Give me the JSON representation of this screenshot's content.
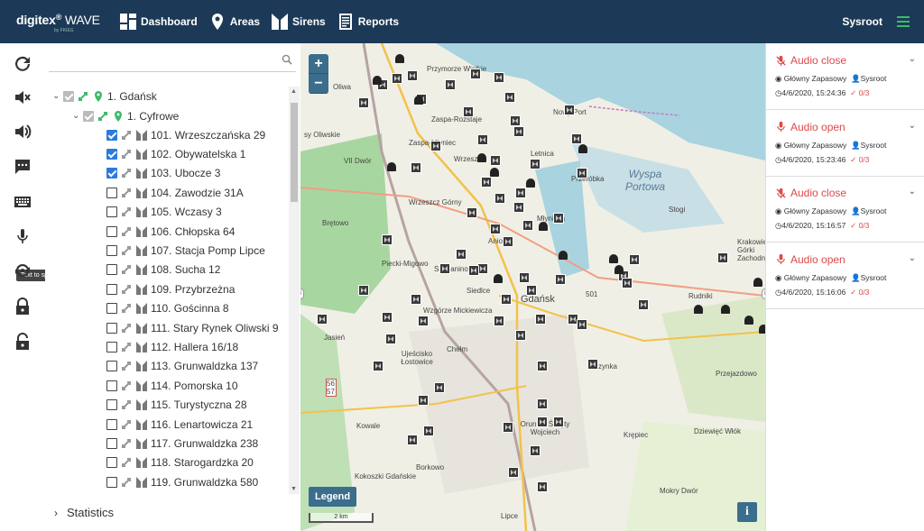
{
  "brand": {
    "name": "digitex",
    "product": "WAVE",
    "sub": "by FKIEG"
  },
  "nav": [
    {
      "label": "Dashboard",
      "icon": "dashboard-icon"
    },
    {
      "label": "Areas",
      "icon": "map-pin-icon"
    },
    {
      "label": "Sirens",
      "icon": "siren-icon"
    },
    {
      "label": "Reports",
      "icon": "report-icon"
    }
  ],
  "user": {
    "name": "Sysroot"
  },
  "toolbar": {
    "tooltip": "Text to speech"
  },
  "tree": {
    "root": "1. Gdańsk",
    "group": "1. Cyfrowe",
    "items": [
      {
        "label": "101. Wrzeszczańska 29",
        "checked": true
      },
      {
        "label": "102. Obywatelska 1",
        "checked": true
      },
      {
        "label": "103. Ubocze 3",
        "checked": true
      },
      {
        "label": "104. Zawodzie 31A",
        "checked": false
      },
      {
        "label": "105. Wczasy 3",
        "checked": false
      },
      {
        "label": "106. Chłopska 64",
        "checked": false
      },
      {
        "label": "107. Stacja Pomp Lipce",
        "checked": false
      },
      {
        "label": "108. Sucha 12",
        "checked": false
      },
      {
        "label": "109. Przybrzeżna",
        "checked": false
      },
      {
        "label": "110. Gościnna 8",
        "checked": false
      },
      {
        "label": "111. Stary Rynek Oliwski 9",
        "checked": false
      },
      {
        "label": "112. Hallera 16/18",
        "checked": false
      },
      {
        "label": "113. Grunwaldzka  137",
        "checked": false
      },
      {
        "label": "114. Pomorska 10",
        "checked": false
      },
      {
        "label": "115. Turystyczna 28",
        "checked": false
      },
      {
        "label": "116. Lenartowicza 21",
        "checked": false
      },
      {
        "label": "117. Grunwaldzka 238",
        "checked": false
      },
      {
        "label": "118. Starogardzka 20",
        "checked": false
      },
      {
        "label": "119. Grunwaldzka 580",
        "checked": false
      }
    ]
  },
  "stats": {
    "label": "Statistics"
  },
  "map": {
    "zoom_in": "+",
    "zoom_out": "−",
    "legend": "Legend",
    "scale": "2 km",
    "info": "i",
    "labels": [
      {
        "text": "Przymorze Wielkie",
        "cls": ""
      },
      {
        "text": "Zaspa-Rozstaje",
        "cls": ""
      },
      {
        "text": "Nowy Port",
        "cls": ""
      },
      {
        "text": "sy Oliwskie",
        "cls": ""
      },
      {
        "text": "VII Dwór",
        "cls": ""
      },
      {
        "text": "Zaspa-Młyniec",
        "cls": ""
      },
      {
        "text": "Wrzeszcz",
        "cls": ""
      },
      {
        "text": "Letnica",
        "cls": ""
      },
      {
        "text": "Przeróbka",
        "cls": ""
      },
      {
        "text": "Wyspa Portowa",
        "cls": "big"
      },
      {
        "text": "Wrzeszcz Górny",
        "cls": ""
      },
      {
        "text": "Stogi",
        "cls": ""
      },
      {
        "text": "Brętowo",
        "cls": ""
      },
      {
        "text": "Młyniska",
        "cls": ""
      },
      {
        "text": "Aniołki",
        "cls": ""
      },
      {
        "text": "Piecki-Migowo",
        "cls": ""
      },
      {
        "text": "Suchanino",
        "cls": ""
      },
      {
        "text": "Siedlce",
        "cls": ""
      },
      {
        "text": "Gdańsk",
        "cls": ""
      },
      {
        "text": "Wzgórze Mickiewicza",
        "cls": ""
      },
      {
        "text": "Jasień",
        "cls": ""
      },
      {
        "text": "Chełm",
        "cls": ""
      },
      {
        "text": "Ujeścisko Łostowice",
        "cls": ""
      },
      {
        "text": "Olszynka",
        "cls": ""
      },
      {
        "text": "Rudniki",
        "cls": ""
      },
      {
        "text": "Przejazdowo",
        "cls": ""
      },
      {
        "text": "Orunia - Święty Wojciech",
        "cls": ""
      },
      {
        "text": "Kowale",
        "cls": ""
      },
      {
        "text": "Krępiec",
        "cls": ""
      },
      {
        "text": "Dziewięć Włók",
        "cls": ""
      },
      {
        "text": "Borkowo",
        "cls": ""
      },
      {
        "text": "Lipce",
        "cls": ""
      },
      {
        "text": "Kokoszki Gdańskie",
        "cls": ""
      },
      {
        "text": "Mokry Dwór",
        "cls": ""
      },
      {
        "text": "Oliwa",
        "cls": ""
      },
      {
        "text": "Krakowiec Górki Zachodnie",
        "cls": ""
      },
      {
        "text": "501",
        "cls": ""
      },
      {
        "text": "56 57",
        "cls": ""
      }
    ]
  },
  "events": [
    {
      "title": "Audio close",
      "source": "Główny Zapasowy",
      "user": "Sysroot",
      "time": "4/6/2020, 15:24:36",
      "count": "0/3",
      "icon": "mic-off-icon"
    },
    {
      "title": "Audio open",
      "source": "Główny Zapasowy",
      "user": "Sysroot",
      "time": "4/6/2020, 15:23:46",
      "count": "0/3",
      "icon": "mic-icon"
    },
    {
      "title": "Audio close",
      "source": "Główny Zapasowy",
      "user": "Sysroot",
      "time": "4/6/2020, 15:16:57",
      "count": "0/3",
      "icon": "mic-off-icon"
    },
    {
      "title": "Audio open",
      "source": "Główny Zapasowy",
      "user": "Sysroot",
      "time": "4/6/2020, 15:16:06",
      "count": "0/3",
      "icon": "mic-icon"
    }
  ]
}
